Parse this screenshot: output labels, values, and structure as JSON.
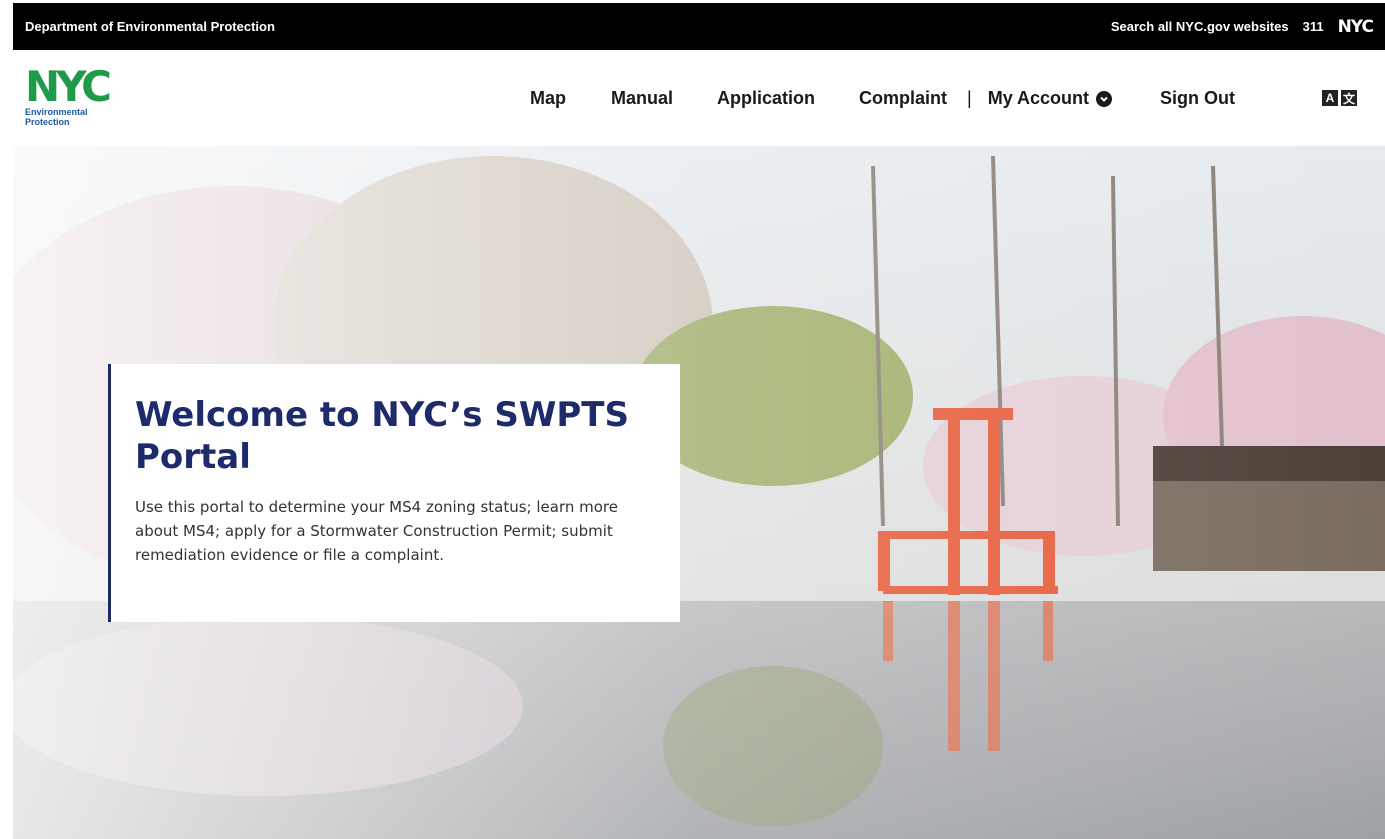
{
  "topbar": {
    "department": "Department of Environmental Protection",
    "search_link": "Search all NYC.gov websites",
    "phone": "311",
    "nyc_logo_text": "NYC"
  },
  "logo": {
    "mark": "NYC",
    "line1": "Environmental",
    "line2": "Protection",
    "color": "#1f9a4a"
  },
  "nav": {
    "map": "Map",
    "manual": "Manual",
    "application": "Application",
    "complaint": "Complaint",
    "separator": "|",
    "my_account": "My Account",
    "sign_out": "Sign Out",
    "translate_icon": "translate-icon"
  },
  "hero": {
    "title": "Welcome to NYC’s SWPTS Portal",
    "description": "Use this portal to determine your MS4 zoning status; learn more about MS4; apply for a Stormwater Construction Permit; submit remediation evidence or file a complaint.",
    "accent_color": "#1c2a63"
  }
}
